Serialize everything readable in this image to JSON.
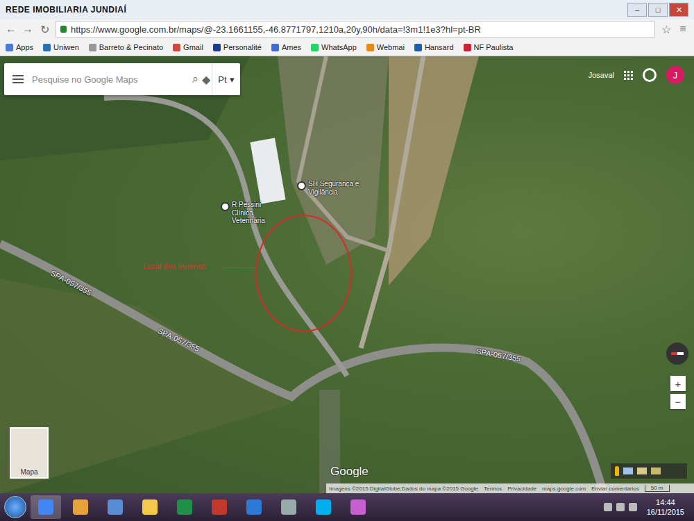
{
  "window": {
    "watermark": "REDE IMOBILIARIA JUNDIAÍ",
    "controls": [
      "–",
      "□",
      "✕"
    ]
  },
  "address_bar": {
    "url": "https://www.google.com.br/maps/@-23.1661155,-46.8771797,1210a,20y,90h/data=!3m1!1e3?hl=pt-BR"
  },
  "bookmarks": [
    "Apps",
    "Uniwen",
    "Barreto & Pecinato",
    "Gmail",
    "Personalité",
    "Ames",
    "WhatsApp",
    "Webmai",
    "Hansard",
    "NF Paulista"
  ],
  "maps": {
    "search_placeholder": "Pesquise no Google Maps",
    "language": "Pt",
    "user_name": "Josaval",
    "avatar": "J",
    "logo": "Google",
    "thumbnail_label": "Mapa",
    "zoom": [
      "+",
      "−"
    ],
    "scale": "50 m",
    "footer": [
      "Imagens ©2015 DigitalGlobe,Dados do mapa ©2015 Google",
      "Termos",
      "Privacidade",
      "maps.google.com",
      "Enviar comentários"
    ]
  },
  "map_labels": [
    {
      "text": "R Pessini Clínica Veterinária",
      "kind": "place"
    },
    {
      "text": "SH Segurança e Vigilância",
      "kind": "place"
    },
    {
      "text": "SPA-057/355",
      "kind": "road"
    },
    {
      "text": "SPA-057/355",
      "kind": "road"
    },
    {
      "text": "SPA-057/355",
      "kind": "road"
    }
  ],
  "annotation": "Local dos terrenos",
  "taskbar": {
    "time": "14:44",
    "date": "16/11/2015"
  }
}
